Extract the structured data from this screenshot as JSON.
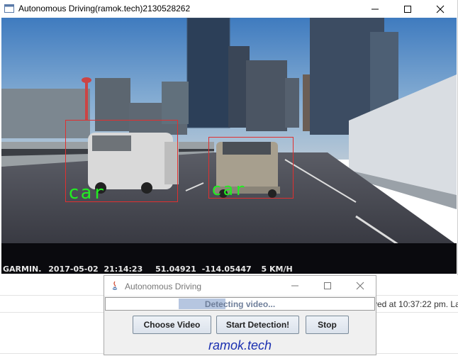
{
  "main_window": {
    "title": "Autonomous Driving(ramok.tech)2130528262"
  },
  "video": {
    "detections": [
      {
        "label": "car",
        "box_color": "#e03030",
        "label_color": "#22ee22"
      },
      {
        "label": "car",
        "box_color": "#e03030",
        "label_color": "#22ee22"
      }
    ],
    "overlay": {
      "brand": "GARMIN.",
      "date": "2017-05-02",
      "time": "21:14:23",
      "lat": "51.04921",
      "lon": "-114.05447",
      "speed": "5 KM/H"
    }
  },
  "background_app": {
    "status_text": "ved at 10:37:22 pm. La"
  },
  "dialog": {
    "title": "Autonomous Driving",
    "progress_text": "Detecting video...",
    "buttons": {
      "choose_video": "Choose Video",
      "start_detection": "Start Detection!",
      "stop": "Stop"
    },
    "brand": "ramok.tech"
  },
  "colors": {
    "brand_text": "#1a2fb0",
    "detection_box": "#e03030",
    "detection_label": "#22ee22"
  }
}
